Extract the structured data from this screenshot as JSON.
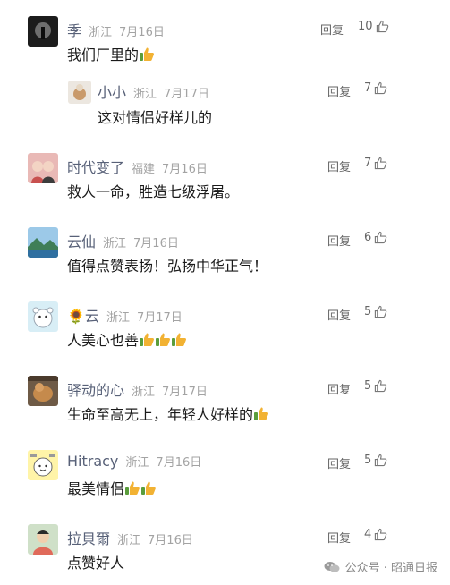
{
  "comments": [
    {
      "name": "季",
      "loc": "浙江",
      "date": "7月16日",
      "text": "我们厂里的",
      "emojis": 1,
      "reply": "回复",
      "likes": "10"
    },
    {
      "name": "小小",
      "loc": "浙江",
      "date": "7月17日",
      "text": "这对情侣好样儿的",
      "emojis": 0,
      "reply": "回复",
      "likes": "7"
    },
    {
      "name": "时代变了",
      "loc": "福建",
      "date": "7月16日",
      "text": "救人一命，胜造七级浮屠。",
      "emojis": 0,
      "reply": "回复",
      "likes": "7"
    },
    {
      "name": "云仙",
      "loc": "浙江",
      "date": "7月16日",
      "text": "值得点赞表扬！弘扬中华正气！",
      "emojis": 0,
      "reply": "回复",
      "likes": "6"
    },
    {
      "name": "🌻云",
      "loc": "浙江",
      "date": "7月17日",
      "text": "人美心也善",
      "emojis": 3,
      "reply": "回复",
      "likes": "5"
    },
    {
      "name": "驿动的心",
      "loc": "浙江",
      "date": "7月17日",
      "text": "生命至高无上，年轻人好样的",
      "emojis": 1,
      "reply": "回复",
      "likes": "5"
    },
    {
      "name": "Hitracy",
      "loc": "浙江",
      "date": "7月16日",
      "text": "最美情侣",
      "emojis": 2,
      "reply": "回复",
      "likes": "5"
    },
    {
      "name": "拉貝爾",
      "loc": "浙江",
      "date": "7月16日",
      "text": "点赞好人",
      "emojis": 0,
      "reply": "回复",
      "likes": "4"
    }
  ],
  "watermark": "公众号 · 昭通日报",
  "colors": {
    "name": "#586178",
    "meta": "#a3a3a3",
    "text": "#1a1a1a",
    "thumb_emoji": "#f2b233"
  }
}
